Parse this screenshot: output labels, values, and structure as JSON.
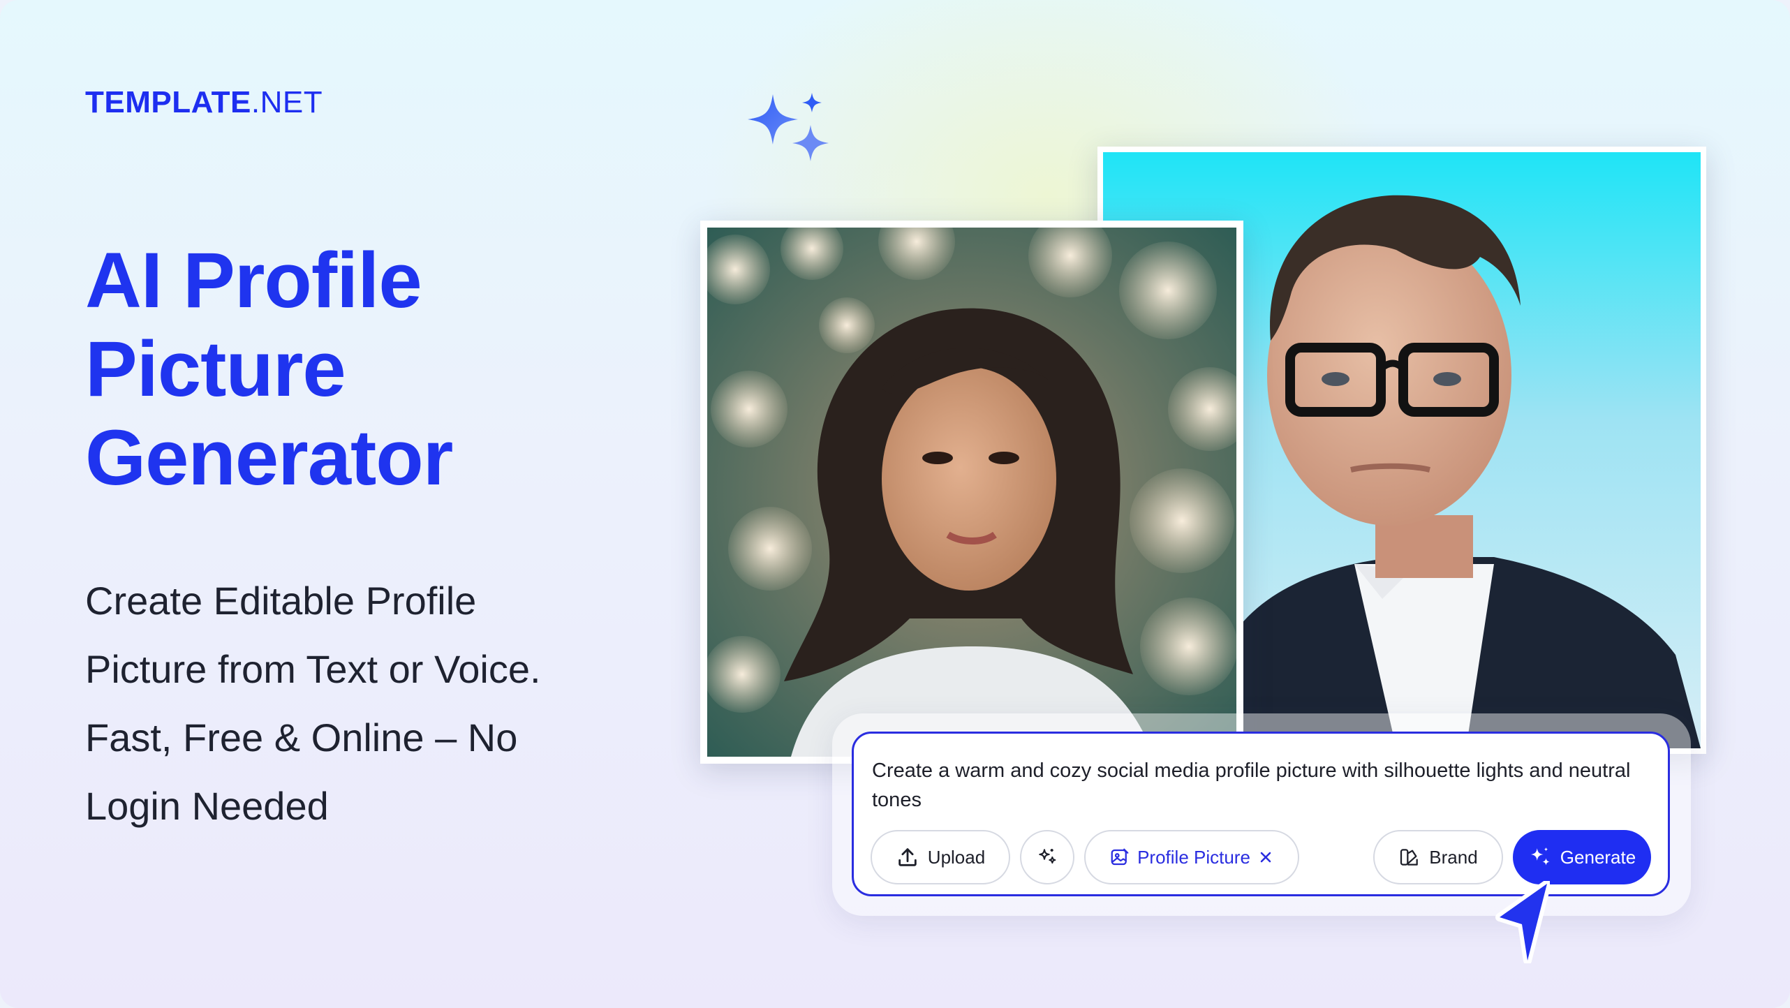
{
  "brand": {
    "name_bold": "TEMPLATE",
    "name_light": ".NET"
  },
  "headline": [
    "AI Profile",
    "Picture",
    "Generator"
  ],
  "subtitle": [
    "Create Editable Profile",
    "Picture from Text or Voice.",
    "Fast, Free & Online – No",
    "Login Needed"
  ],
  "prompt": {
    "text": "Create a warm and cozy social media profile picture with silhouette lights and neutral tones",
    "upload_label": "Upload",
    "chip_label": "Profile Picture",
    "brand_label": "Brand",
    "generate_label": "Generate"
  },
  "icons": {
    "sparkles": "sparkles-icon",
    "upload": "upload-icon",
    "magic": "magic-sparkle-icon",
    "chip": "image-edit-icon",
    "chip_remove": "close-icon",
    "brand": "brand-palette-icon",
    "generate": "sparkle-icon",
    "cursor": "pointer-cursor-icon"
  },
  "colors": {
    "accent": "#1f2ef2",
    "headline": "#1f34ef",
    "text": "#1e2230"
  }
}
